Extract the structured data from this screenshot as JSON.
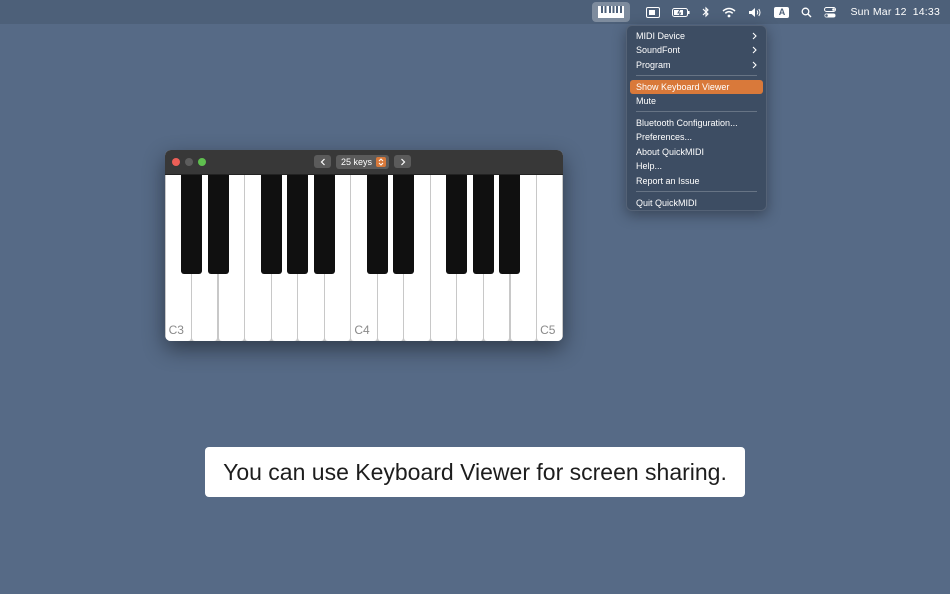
{
  "menubar": {
    "icons": [
      "piano-icon",
      "display-icon",
      "battery-icon",
      "bluetooth-icon",
      "wifi-icon",
      "volume-icon",
      "input-source-icon",
      "search-icon",
      "control-center-icon"
    ],
    "input_source": "A",
    "date": "Sun Mar 12",
    "time": "14:33"
  },
  "menu": {
    "items": [
      {
        "label": "MIDI Device",
        "submenu": true
      },
      {
        "label": "SoundFont",
        "submenu": true
      },
      {
        "label": "Program",
        "submenu": true
      },
      {
        "label": "Show Keyboard Viewer",
        "highlighted": true
      },
      {
        "label": "Mute"
      },
      {
        "label": "Bluetooth Configuration..."
      },
      {
        "label": "Preferences..."
      },
      {
        "label": "About QuickMIDI"
      },
      {
        "label": "Help..."
      },
      {
        "label": "Report an Issue"
      },
      {
        "label": "Quit QuickMIDI"
      }
    ]
  },
  "keyboard_window": {
    "keys_selector": "25 keys",
    "octave_labels": [
      "C3",
      "C4",
      "C5"
    ]
  },
  "caption": "You can use Keyboard Viewer for screen sharing.",
  "colors": {
    "desktop": "#566a86",
    "menubar": "#4d6079",
    "menu_background": "#3d4d63",
    "highlight": "#d9793a"
  }
}
